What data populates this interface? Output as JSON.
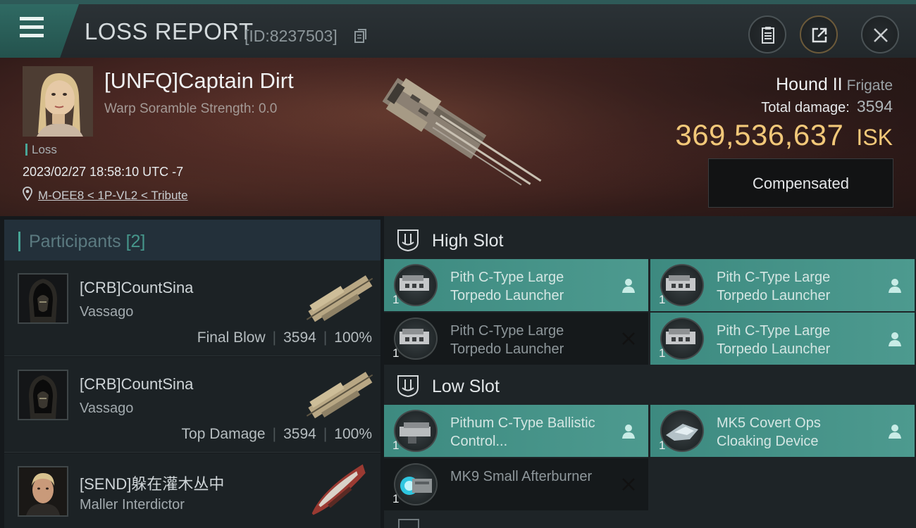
{
  "header": {
    "title": "LOSS REPORT",
    "report_id": "[ID:8237503]"
  },
  "victim": {
    "name": "[UNFQ]Captain Dirt",
    "scramble": "Warp Soramble Strength: 0.0",
    "tag": "Loss",
    "datetime": "2023/02/27 18:58:10 UTC -7",
    "location": "M-OEE8 < 1P-VL2 < Tribute",
    "ship_name": "Hound II",
    "ship_class": "Frigate",
    "damage_label": "Total damage:",
    "damage_value": "3594",
    "isk_value": "369,536,637",
    "isk_unit": "ISK",
    "compensated_label": "Compensated"
  },
  "participants": {
    "title": "Participants",
    "count": "[2]",
    "rows": [
      {
        "name": "[CRB]CountSina",
        "ship": "Vassago",
        "label": "Final Blow",
        "damage": "3594",
        "percent": "100%"
      },
      {
        "name": "[CRB]CountSina",
        "ship": "Vassago",
        "label": "Top Damage",
        "damage": "3594",
        "percent": "100%"
      },
      {
        "name": "[SEND]躲在灌木丛中",
        "ship": "Maller Interdictor"
      }
    ]
  },
  "slots": {
    "high": {
      "title": "High Slot",
      "modules": [
        {
          "name": "Pith C-Type Large Torpedo Launcher",
          "qty": "1",
          "status": "fitted"
        },
        {
          "name": "Pith C-Type Large Torpedo Launcher",
          "qty": "1",
          "status": "fitted"
        },
        {
          "name": "Pith C-Type Large Torpedo Launcher",
          "qty": "1",
          "status": "dropped"
        },
        {
          "name": "Pith C-Type Large Torpedo Launcher",
          "qty": "1",
          "status": "fitted"
        }
      ]
    },
    "low": {
      "title": "Low Slot",
      "modules": [
        {
          "name": "Pithum C-Type Ballistic Control...",
          "qty": "1",
          "status": "fitted"
        },
        {
          "name": "MK5 Covert Ops Cloaking Device",
          "qty": "1",
          "status": "fitted"
        },
        {
          "name": "MK9 Small Afterburner",
          "qty": "1",
          "status": "dropped"
        }
      ]
    }
  },
  "colors": {
    "accent": "#47a596",
    "isk": "#f2c879",
    "fitted": "#4d9a8f"
  }
}
